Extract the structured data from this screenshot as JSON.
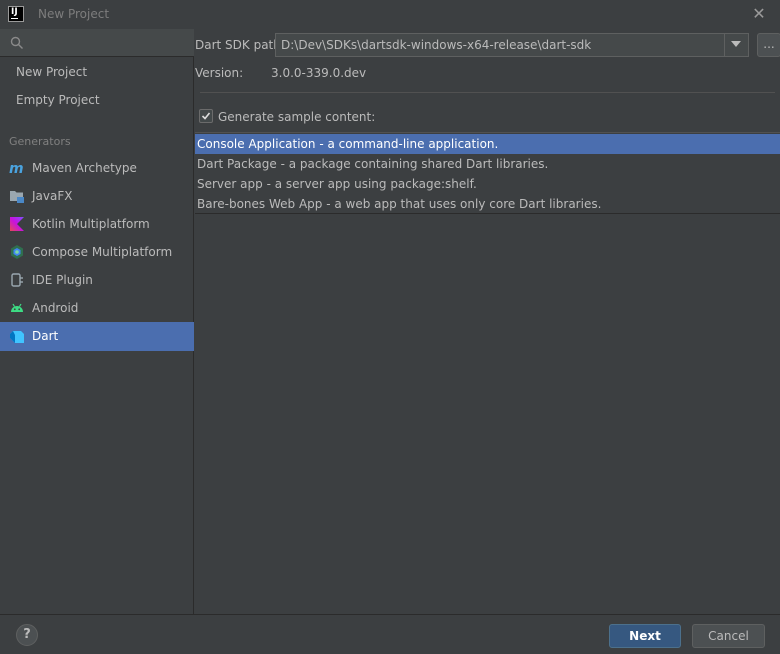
{
  "window": {
    "title": "New Project",
    "logo_text": "IJ"
  },
  "sidebar": {
    "search": {
      "value": "",
      "placeholder": ""
    },
    "top_items": [
      {
        "label": "New Project"
      },
      {
        "label": "Empty Project"
      }
    ],
    "generators_label": "Generators",
    "generators": [
      {
        "label": "Maven Archetype",
        "icon": "maven-icon"
      },
      {
        "label": "JavaFX",
        "icon": "javafx-folder-icon"
      },
      {
        "label": "Kotlin Multiplatform",
        "icon": "kotlin-icon"
      },
      {
        "label": "Compose Multiplatform",
        "icon": "compose-icon"
      },
      {
        "label": "IDE Plugin",
        "icon": "plugin-icon"
      },
      {
        "label": "Android",
        "icon": "android-icon"
      },
      {
        "label": "Dart",
        "icon": "dart-icon",
        "selected": true
      }
    ]
  },
  "main": {
    "sdk_label": "Dart SDK path:",
    "sdk_path": "D:\\Dev\\SDKs\\dartsdk-windows-x64-release\\dart-sdk",
    "browse_label": "...",
    "version_label": "Version:",
    "version_value": "3.0.0-339.0.dev",
    "generate_sample": {
      "label": "Generate sample content:",
      "checked": true
    },
    "templates": [
      {
        "label": "Console Application - a command-line application.",
        "selected": true
      },
      {
        "label": "Dart Package - a package containing shared Dart libraries."
      },
      {
        "label": "Server app - a server app using package:shelf."
      },
      {
        "label": "Bare-bones Web App - a web app that uses only core Dart libraries."
      }
    ]
  },
  "footer": {
    "help_label": "?",
    "next_label": "Next",
    "cancel_label": "Cancel"
  },
  "colors": {
    "background": "#3c3f41",
    "selection": "#4b6eaf",
    "primary_button": "#365880"
  }
}
